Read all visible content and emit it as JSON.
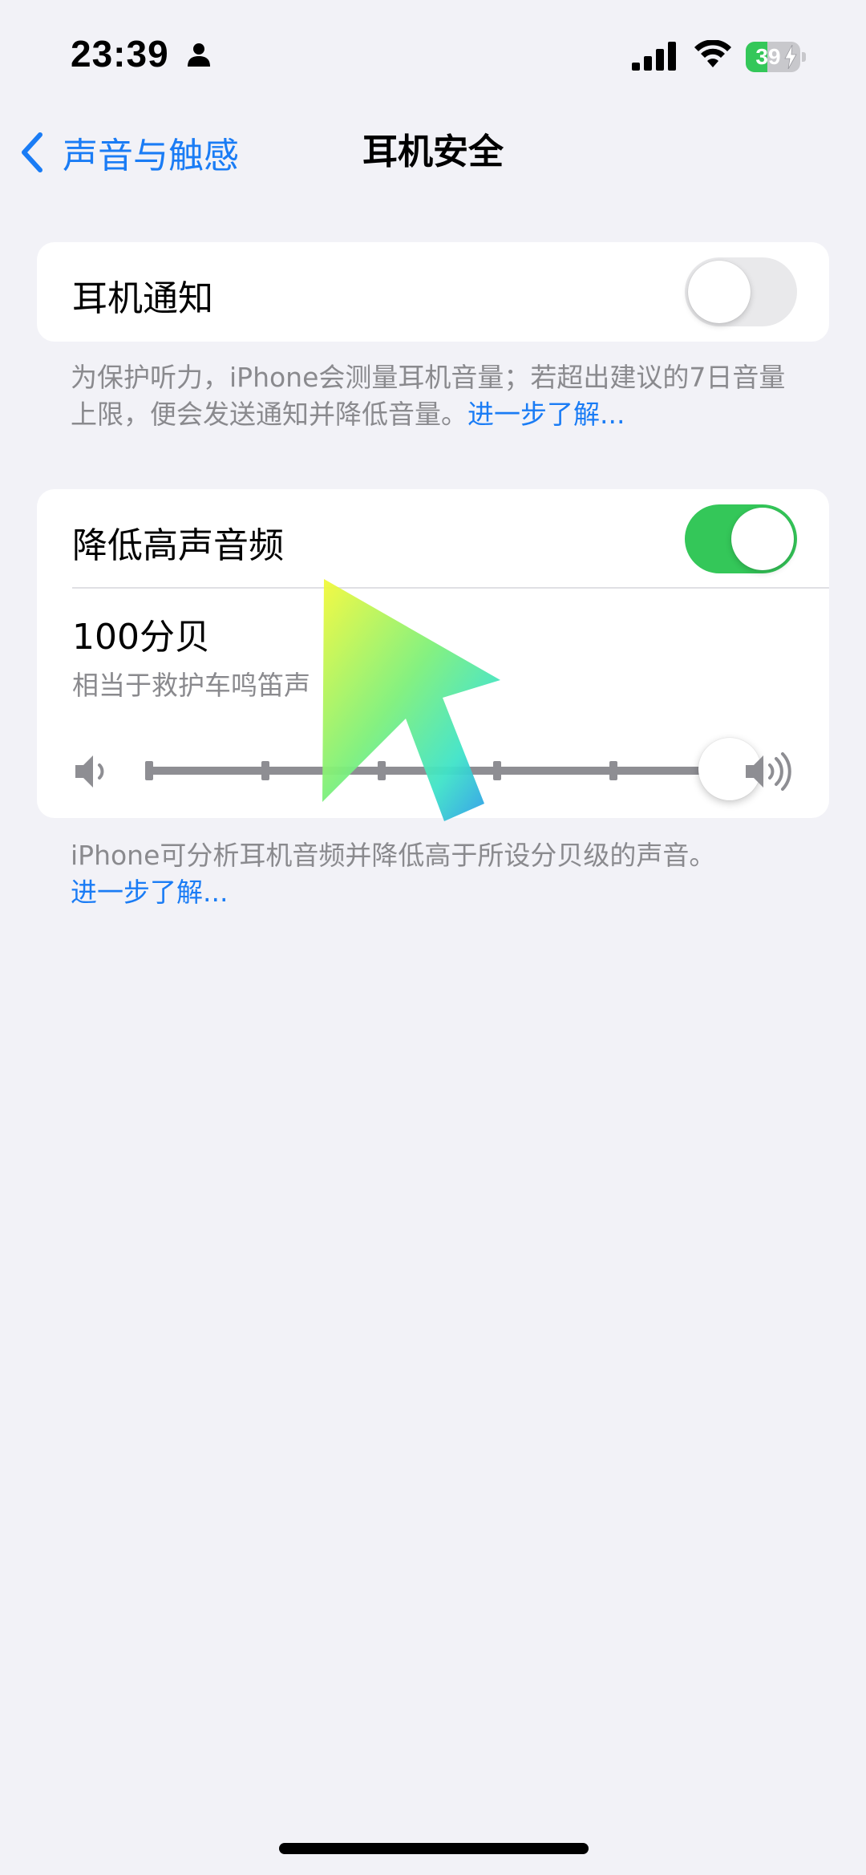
{
  "status_bar": {
    "time": "23:39",
    "battery": "39",
    "battery_level": 0.39
  },
  "nav": {
    "back_label": "声音与触感",
    "title": "耳机安全"
  },
  "headphone_notifications": {
    "label": "耳机通知",
    "enabled": false,
    "footnote": "为保护听力，iPhone会测量耳机音量；若超出建议的7日音量上限，便会发送通知并降低音量。",
    "footnote_link": "进一步了解..."
  },
  "reduce_loud_audio": {
    "label": "降低高声音频",
    "enabled": true,
    "level_label": "100分贝",
    "level_desc": "相当于救护车鸣笛声",
    "slider_value": 100,
    "slider_steps": [
      75,
      80,
      85,
      90,
      95,
      100
    ],
    "footnote": "iPhone可分析耳机音频并降低高于所设分贝级的声音。",
    "footnote_link": "进一步了解..."
  }
}
